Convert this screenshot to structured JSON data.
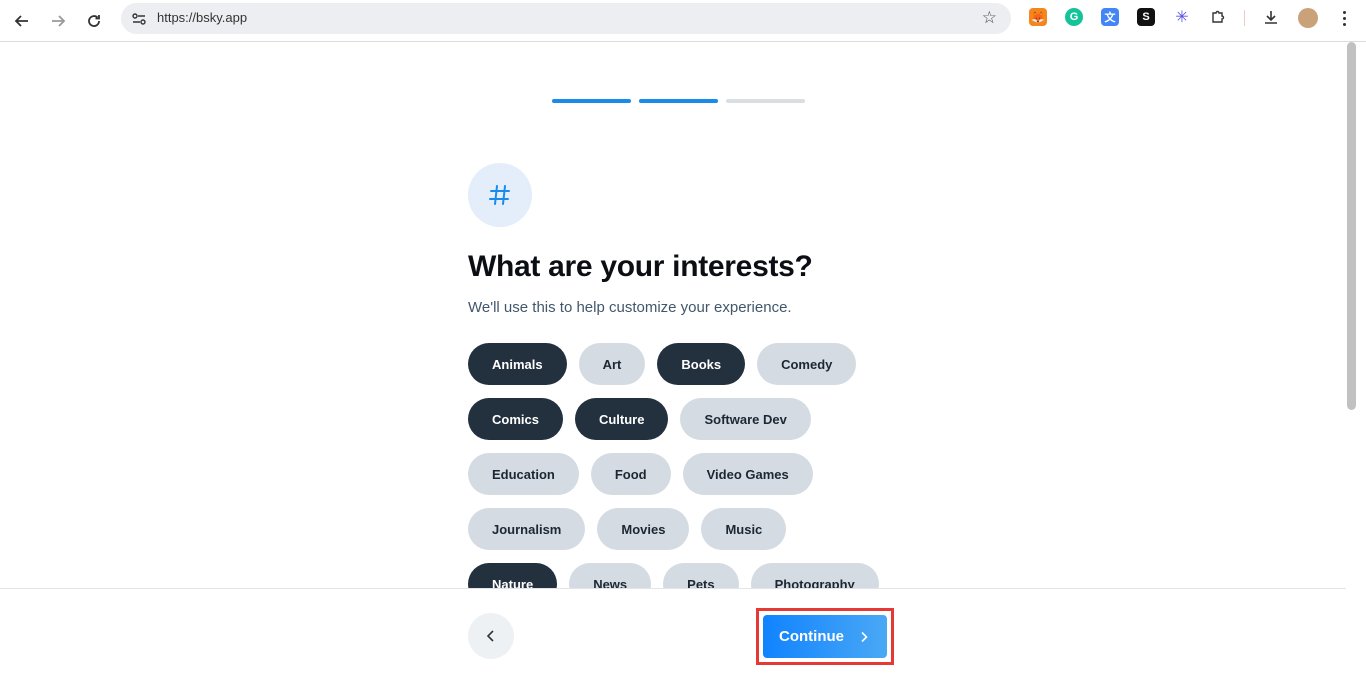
{
  "browser": {
    "url": "https://bsky.app"
  },
  "onboarding": {
    "title": "What are your interests?",
    "subtitle": "We'll use this to help customize your experience.",
    "progress": {
      "total_steps": 3,
      "completed_steps": 2
    },
    "icon": "hash-icon",
    "interests": [
      [
        {
          "label": "Animals",
          "selected": true
        },
        {
          "label": "Art",
          "selected": false
        },
        {
          "label": "Books",
          "selected": true
        },
        {
          "label": "Comedy",
          "selected": false
        }
      ],
      [
        {
          "label": "Comics",
          "selected": true
        },
        {
          "label": "Culture",
          "selected": true
        },
        {
          "label": "Software Dev",
          "selected": false
        }
      ],
      [
        {
          "label": "Education",
          "selected": false
        },
        {
          "label": "Food",
          "selected": false
        },
        {
          "label": "Video Games",
          "selected": false
        }
      ],
      [
        {
          "label": "Journalism",
          "selected": false
        },
        {
          "label": "Movies",
          "selected": false
        },
        {
          "label": "Music",
          "selected": false
        }
      ],
      [
        {
          "label": "Nature",
          "selected": true
        },
        {
          "label": "News",
          "selected": false
        },
        {
          "label": "Pets",
          "selected": false
        },
        {
          "label": "Photography",
          "selected": false
        }
      ]
    ]
  },
  "footer": {
    "continue_label": "Continue"
  },
  "colors": {
    "accent": "#1083fe",
    "chip_selected": "#23303d",
    "chip_default": "#d4dbe2",
    "highlight": "#e53935"
  }
}
